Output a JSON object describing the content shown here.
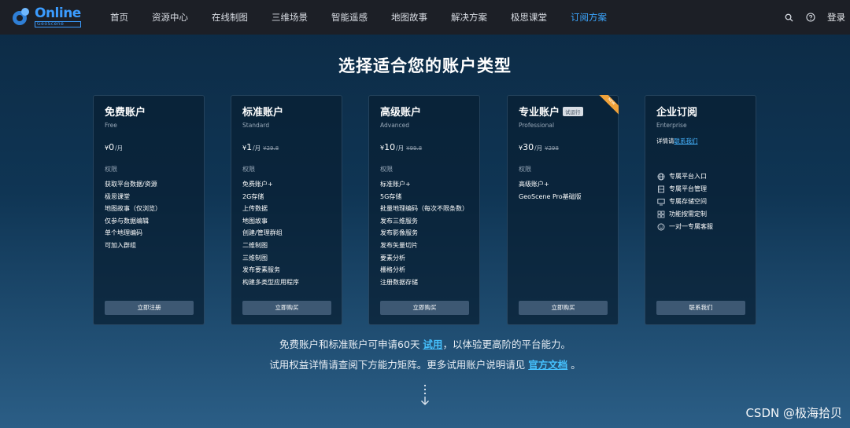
{
  "nav": {
    "logo_main": "Online",
    "logo_sub": "GeoScene",
    "items": [
      "首页",
      "资源中心",
      "在线制图",
      "三维场景",
      "智能遥感",
      "地图故事",
      "解决方案",
      "极思课堂",
      "订阅方案"
    ],
    "active_index": 8,
    "login": "登录",
    "icons": [
      "search-icon",
      "help-icon"
    ]
  },
  "headline": "选择适合您的账户类型",
  "plans": [
    {
      "title": "免费账户",
      "subtitle": "Free",
      "price_currency": "¥",
      "price": "0",
      "unit": "/月",
      "old_price": "",
      "perm_title": "权限",
      "perms": [
        "获取平台数据/资源",
        "极思课堂",
        "地图故事（仅浏览）",
        "仅参与数据编辑",
        "单个地理编码",
        "可加入群组"
      ],
      "button": "立即注册"
    },
    {
      "title": "标准账户",
      "subtitle": "Standard",
      "price_currency": "¥",
      "price": "1",
      "unit": "/月",
      "old_price": "¥29.8",
      "perm_title": "权限",
      "perms": [
        "免费账户+",
        "2G存储",
        "上传数据",
        "地图故事",
        "创建/管理群组",
        "二维制图",
        "三维制图",
        "发布要素服务",
        "构建多类型应用程序"
      ],
      "button": "立即购买"
    },
    {
      "title": "高级账户",
      "subtitle": "Advanced",
      "price_currency": "¥",
      "price": "10",
      "unit": "/月",
      "old_price": "¥99.8",
      "perm_title": "权限",
      "perms": [
        "标准账户+",
        "5G存储",
        "批量地理编码（每次不限条数）",
        "发布三维服务",
        "发布影像服务",
        "发布矢量切片",
        "要素分析",
        "栅格分析",
        "注册数据存储"
      ],
      "button": "立即购买"
    },
    {
      "title": "专业账户",
      "tag": "试运行",
      "ribbon": "NEW",
      "subtitle": "Professional",
      "price_currency": "¥",
      "price": "30",
      "unit": "/月",
      "old_price": "¥298",
      "perm_title": "权限",
      "perms": [
        "高级账户+",
        "GeoScene Pro基础版"
      ],
      "button": "立即购买"
    },
    {
      "title": "企业订阅",
      "subtitle": "Enterprise",
      "contact_prefix": "详情请",
      "contact_link": "联系我们",
      "features": [
        {
          "icon": "globe-icon",
          "text": "专属平台入口"
        },
        {
          "icon": "server-icon",
          "text": "专属平台管理"
        },
        {
          "icon": "monitor-icon",
          "text": "专属存储空间"
        },
        {
          "icon": "grid-icon",
          "text": "功能按需定制"
        },
        {
          "icon": "smile-icon",
          "text": "一对一专属客服"
        }
      ],
      "button": "联系我们"
    }
  ],
  "note1": {
    "prefix": "免费账户和标准账户可申请60天 ",
    "link": "试用",
    "suffix": "，以体验更高阶的平台能力。"
  },
  "note2": {
    "prefix": "试用权益详情请查阅下方能力矩阵。更多试用账户说明请见 ",
    "link": "官方文档",
    "suffix": " 。"
  },
  "watermark": "CSDN @极海拾贝"
}
